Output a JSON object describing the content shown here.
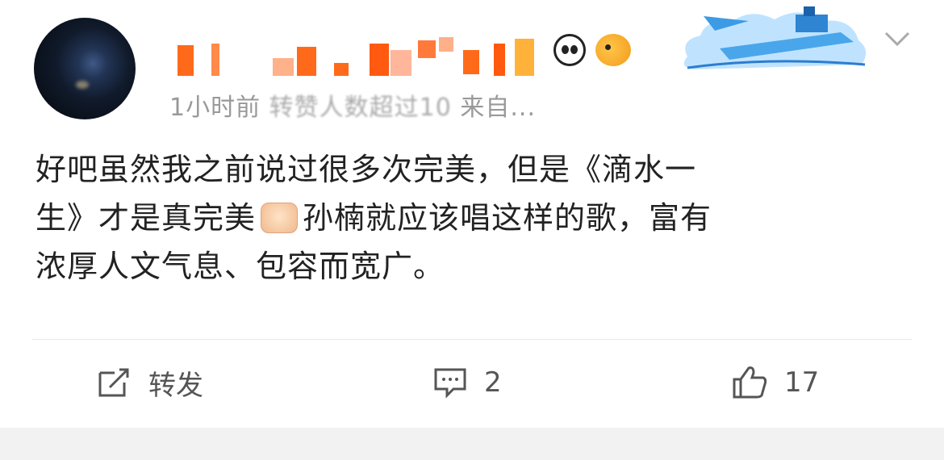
{
  "post": {
    "timestamp": "1小时前",
    "repost_note": "转赞人数超过10",
    "source_prefix": "来自...",
    "content_line1": "好吧虽然我之前说过很多次完美，但是《滴水一",
    "content_line2_a": "生》才是真完美",
    "content_line2_b": "孙楠就应该唱这样的歌，富有",
    "content_line3": "浓厚人文气息、包容而宽广。"
  },
  "actions": {
    "repost_label": "转发",
    "comment_count": "2",
    "like_count": "17"
  },
  "icons": {
    "menu": "chevron-down-icon",
    "repost": "share-icon",
    "comment": "comment-icon",
    "like": "thumbs-up-icon",
    "fist": "fist-emoji",
    "panda": "panda-emoji",
    "fish": "fish-emoji"
  },
  "colors": {
    "text": "#222222",
    "meta": "#999999",
    "divider": "#e6e6e6"
  }
}
